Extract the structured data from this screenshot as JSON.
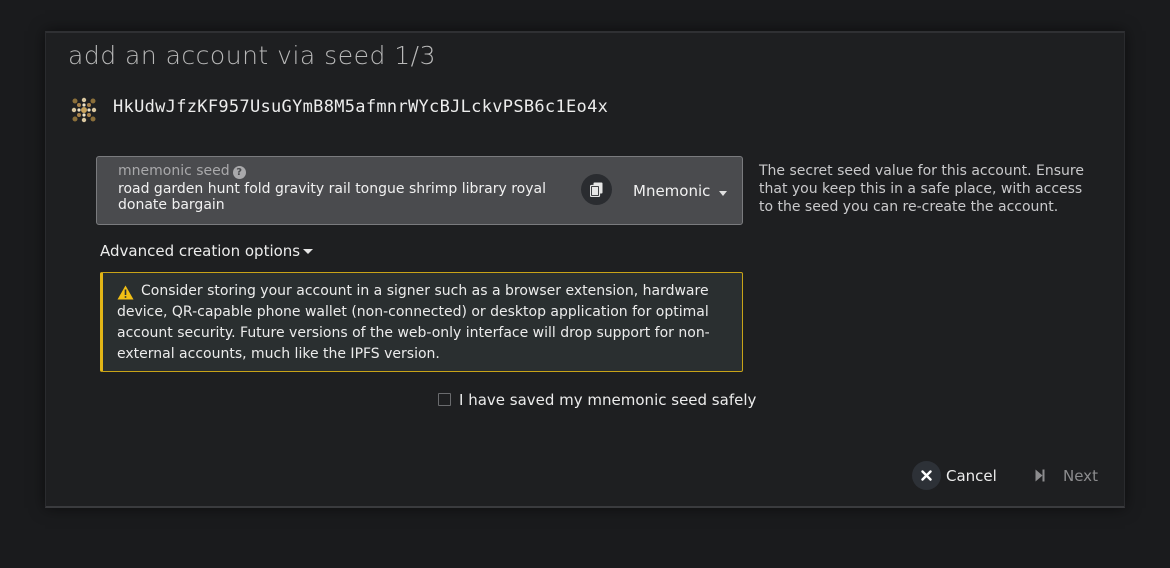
{
  "modal": {
    "title": "add an account via seed 1/3",
    "address": "HkUdwJfzKF957UsuGYmB8M5afmnrWYcBJLckvPSB6c1Eo4x"
  },
  "seed": {
    "label": "mnemonic seed",
    "value": "road garden hunt fold gravity rail tongue shrimp library royal donate bargain",
    "type_selected": "Mnemonic",
    "help_text": "The secret seed value for this account. Ensure that you keep this in a safe place, with access to the seed you can re-create the account."
  },
  "advanced": {
    "label": "Advanced creation options"
  },
  "warning": {
    "text": "Consider storing your account in a signer such as a browser extension, hardware device, QR-capable phone wallet (non-connected) or desktop application for optimal account security. Future versions of the web-only interface will drop support for non-external accounts, much like the IPFS version."
  },
  "confirm": {
    "label": "I have saved my mnemonic seed safely",
    "checked": false
  },
  "actions": {
    "cancel_label": "Cancel",
    "next_label": "Next"
  },
  "colors": {
    "warning_border": "#e2b516",
    "background": "#1e1f21",
    "input_bg": "#4a4b4e"
  }
}
